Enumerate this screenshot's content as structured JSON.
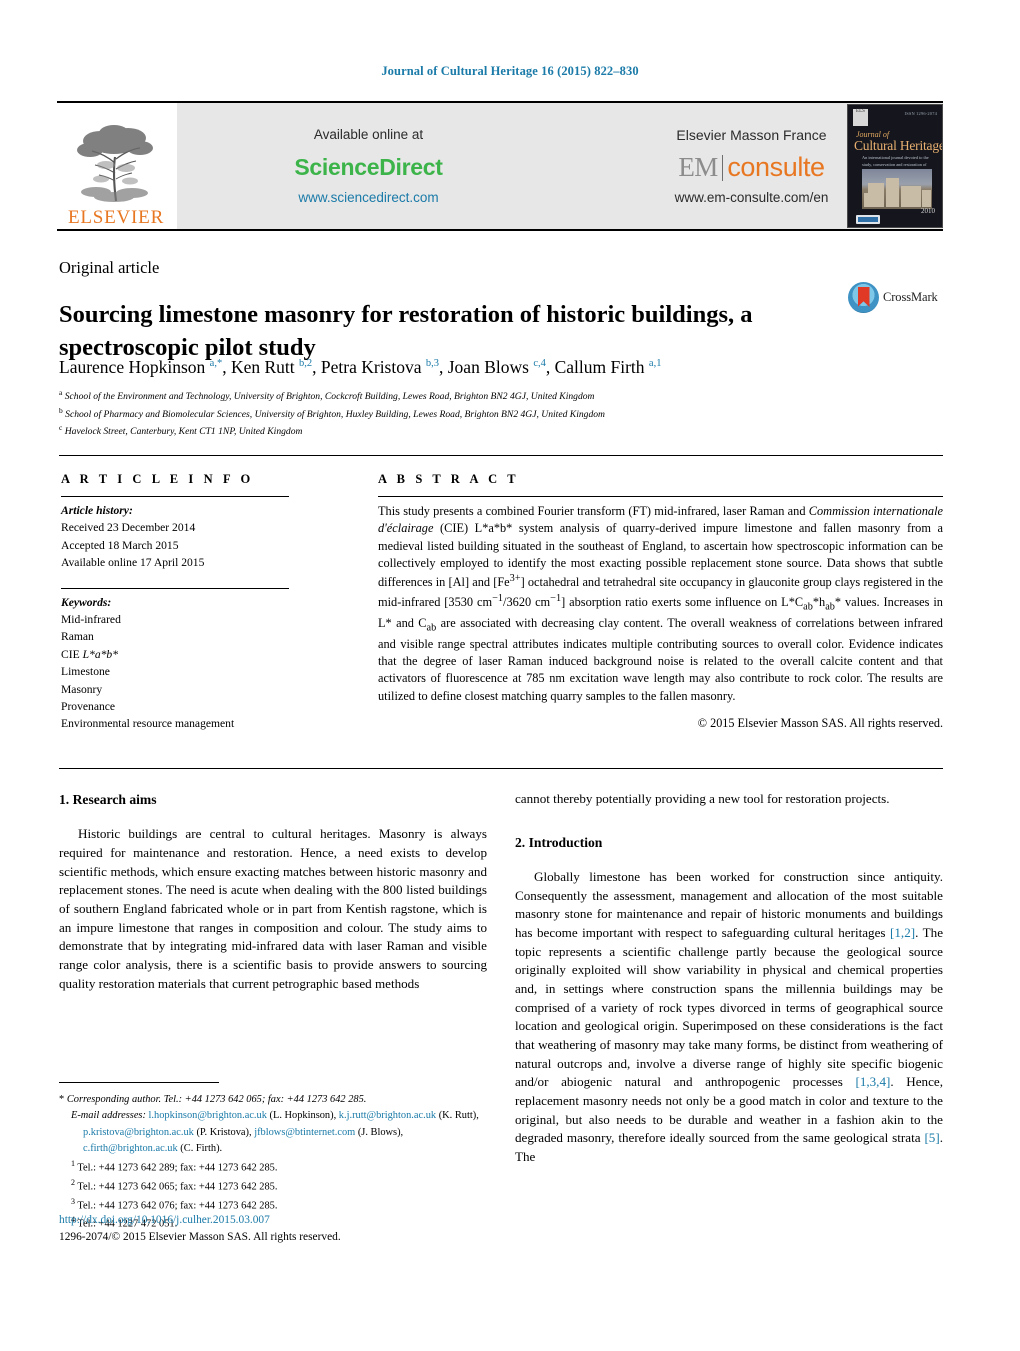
{
  "running_head": "Journal of Cultural Heritage 16 (2015) 822–830",
  "masthead": {
    "publisher_name": "ELSEVIER",
    "available_online_at": "Available online at",
    "sciencedirect_label": "ScienceDirect",
    "sciencedirect_url": "www.sciencedirect.com",
    "elsevier_masson_france": "Elsevier Masson France",
    "em_logo_left": "EM",
    "em_logo_right": "consulte",
    "em_url": "www.em-consulte.com/en"
  },
  "cover": {
    "publisher_mark": "ELS",
    "top_right": "ISSN 1296-2074",
    "journal_of": "Journal of",
    "journal_title": "Cultural Heritage",
    "subtitle": "An international journal devoted to the study, conservation and restoration of cultural heritage",
    "year": "2010",
    "badge": "Elsevier"
  },
  "article_type": "Original article",
  "title": "Sourcing limestone masonry for restoration of historic buildings, a spectroscopic pilot study",
  "crossmark_label": "CrossMark",
  "authors_html": "Laurence Hopkinson <sup>a,*</sup>, Ken Rutt <sup>b,2</sup>, Petra Kristova <sup>b,3</sup>, Joan Blows <sup>c,4</sup>, Callum Firth <sup>a,1</sup>",
  "affiliations": [
    {
      "marker": "a",
      "text": "School of the Environment and Technology, University of Brighton, Cockcroft Building, Lewes Road, Brighton BN2 4GJ, United Kingdom"
    },
    {
      "marker": "b",
      "text": "School of Pharmacy and Biomolecular Sciences, University of Brighton, Huxley Building, Lewes Road, Brighton BN2 4GJ, United Kingdom"
    },
    {
      "marker": "c",
      "text": "Havelock Street, Canterbury, Kent CT1 1NP, United Kingdom"
    }
  ],
  "article_info": {
    "heading": "A R T I C L E   I N F O",
    "history_label": "Article history:",
    "history": [
      "Received 23 December 2014",
      "Accepted 18 March 2015",
      "Available online 17 April 2015"
    ],
    "keywords_label": "Keywords:",
    "keywords": [
      "Mid-infrared",
      "Raman",
      "CIE L*a*b*",
      "Limestone",
      "Masonry",
      "Provenance",
      "Environmental resource management"
    ]
  },
  "abstract": {
    "heading": "A B S T R A C T",
    "body_html": "This study presents a combined Fourier transform (FT) mid-infrared, laser Raman and <i>Commission internationale d'éclairage</i> (CIE) L*a*b* system analysis of quarry-derived impure limestone and fallen masonry from a medieval listed building situated in the southeast of England, to ascertain how spectroscopic information can be collectively employed to identify the most exacting possible replacement stone source. Data shows that subtle differences in [Al] and [Fe<sup>3+</sup>] octahedral and tetrahedral site occupancy in glauconite group clays registered in the mid-infrared [3530 cm<sup>−1</sup>/3620 cm<sup>−1</sup>] absorption ratio exerts some influence on L*C<sub>ab</sub>*h<sub>ab</sub>* values. Increases in L* and C<sub>ab</sub> are associated with decreasing clay content. The overall weakness of correlations between infrared and visible range spectral attributes indicates multiple contributing sources to overall color. Evidence indicates that the degree of laser Raman induced background noise is related to the overall calcite content and that activators of fluorescence at 785 nm excitation wave length may also contribute to rock color. The results are utilized to define closest matching quarry samples to the fallen masonry.",
    "copyright": "© 2015 Elsevier Masson SAS. All rights reserved."
  },
  "sections": {
    "research_aims": {
      "heading": "1.  Research aims",
      "paragraph": "Historic buildings are central to cultural heritages. Masonry is always required for maintenance and restoration. Hence, a need exists to develop scientific methods, which ensure exacting matches between historic masonry and replacement stones. The need is acute when dealing with the 800 listed buildings of southern England fabricated whole or in part from Kentish ragstone, which is an impure limestone that ranges in composition and colour. The study aims to demonstrate that by integrating mid-infrared data with laser Raman and visible range color analysis, there is a scientific basis to provide answers to sourcing quality restoration materials that current petrographic based methods"
    },
    "continuation": "cannot thereby potentially providing a new tool for restoration projects.",
    "introduction": {
      "heading": "2.  Introduction",
      "paragraph_html": "Globally limestone has been worked for construction since antiquity. Consequently the assessment, management and allocation of the most suitable masonry stone for maintenance and repair of historic monuments and buildings has become important with respect to safeguarding cultural heritages <span class=\"ref\">[1,2]</span>. The topic represents a scientific challenge partly because the geological source originally exploited will show variability in physical and chemical properties and, in settings where construction spans the millennia buildings may be comprised of a variety of rock types divorced in terms of geographical source location and geological origin. Superimposed on these considerations is the fact that weathering of masonry may take many forms, be distinct from weathering of natural outcrops and, involve a diverse range of highly site specific biogenic and/or abiogenic natural and anthropogenic processes <span class=\"ref\">[1,3,4]</span>. Hence, replacement masonry needs not only be a good match in color and texture to the original, but also needs to be durable and weather in a fashion akin to the degraded masonry, therefore ideally sourced from the same geological strata <span class=\"ref\">[5]</span>. The"
    }
  },
  "footnotes": {
    "corresponding_html": "<span class=\"plain\">*</span> <i>Corresponding author. Tel.: +44 1273 642 065; fax: +44 1273 642 285.</i>",
    "email_label": "E-mail addresses:",
    "emails_html": "<a class=\"link\" href=\"#\">l.hopkinson@brighton.ac.uk</a> (L. Hopkinson), <a class=\"link\" href=\"#\">k.j.rutt@brighton.ac.uk</a> (K. Rutt), <a class=\"link\" href=\"#\">p.kristova@brighton.ac.uk</a> (P. Kristova), <a class=\"link\" href=\"#\">jfblows@btinternet.com</a> (J. Blows), <a class=\"link\" href=\"#\">c.firth@brighton.ac.uk</a> (C. Firth).",
    "numbered": [
      {
        "marker": "1",
        "text": "Tel.: +44 1273 642 289; fax: +44 1273 642 285."
      },
      {
        "marker": "2",
        "text": "Tel.: +44 1273 642 065; fax: +44 1273 642 285."
      },
      {
        "marker": "3",
        "text": "Tel.: +44 1273 642 076; fax: +44 1273 642 285."
      },
      {
        "marker": "4",
        "text": "Tel.: +44 1227 472 051."
      }
    ]
  },
  "doi": {
    "url": "http://dx.doi.org/10.1016/j.culher.2015.03.007",
    "issn_line": "1296-2074/© 2015 Elsevier Masson SAS. All rights reserved."
  },
  "colors": {
    "link": "#1a7aa8",
    "elsevier_orange": "#E87722",
    "sciencedirect_green": "#3cb44a"
  }
}
